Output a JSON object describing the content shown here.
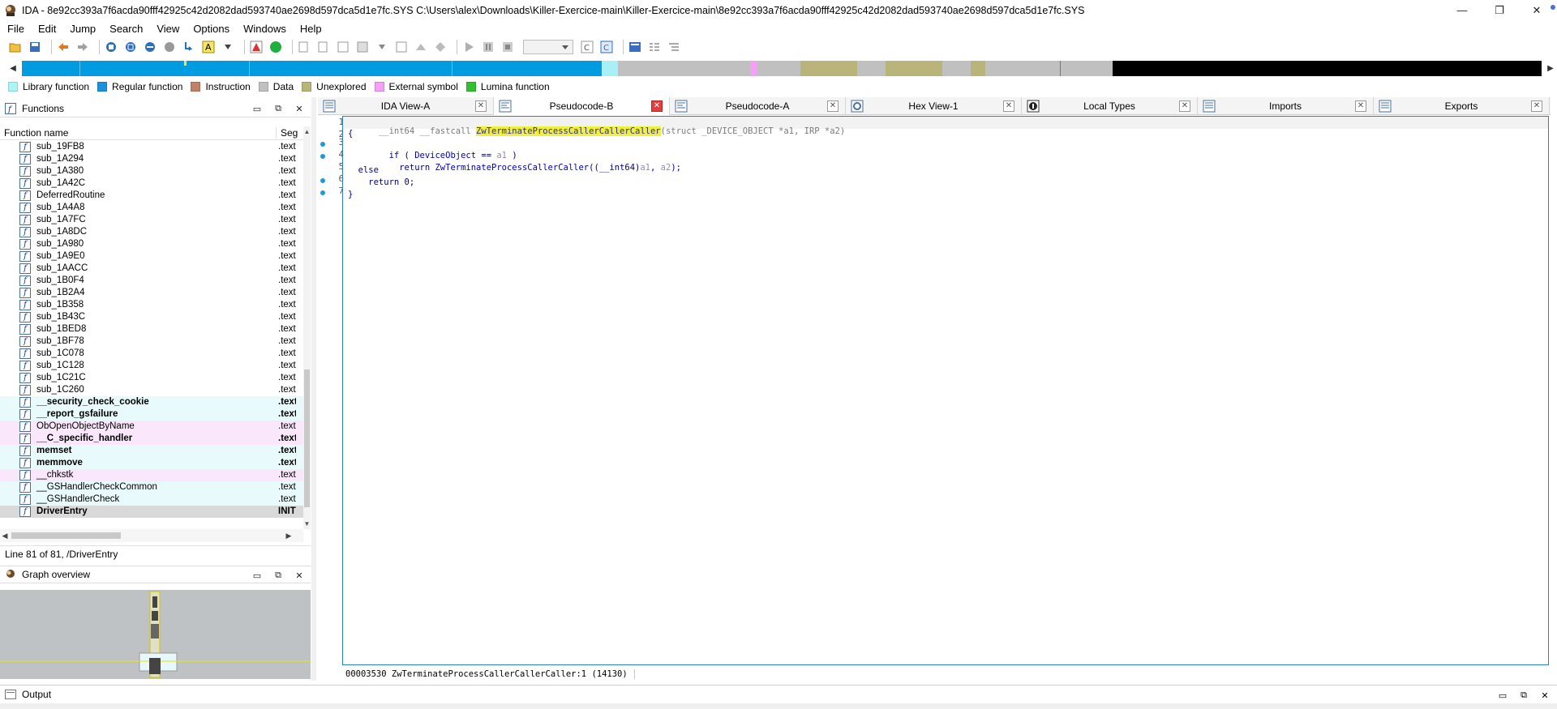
{
  "window": {
    "title": "IDA - 8e92cc393a7f6acda90fff42925c42d2082dad593740ae2698d597dca5d1e7fc.SYS C:\\Users\\alex\\Downloads\\Killer-Exercice-main\\Killer-Exercice-main\\8e92cc393a7f6acda90fff42925c42d2082dad593740ae2698d597dca5d1e7fc.SYS",
    "minimize": "—",
    "restore": "❐",
    "close": "✕"
  },
  "menu": [
    "File",
    "Edit",
    "Jump",
    "Search",
    "View",
    "Options",
    "Windows",
    "Help"
  ],
  "legend": [
    {
      "label": "Library function",
      "color": "#aaf6f6"
    },
    {
      "label": "Regular function",
      "color": "#1e90e0"
    },
    {
      "label": "Instruction",
      "color": "#c0806a"
    },
    {
      "label": "Data",
      "color": "#c0c0c0"
    },
    {
      "label": "Unexplored",
      "color": "#b8b47a"
    },
    {
      "label": "External symbol",
      "color": "#f4a0f4"
    },
    {
      "label": "Lumina function",
      "color": "#30c030"
    }
  ],
  "functions_panel": {
    "title": "Functions",
    "col_name": "Function name",
    "col_seg": "Seg",
    "rows": [
      {
        "name": "sub_19FB8",
        "seg": ".text",
        "kind": "reg"
      },
      {
        "name": "sub_1A294",
        "seg": ".text",
        "kind": "reg"
      },
      {
        "name": "sub_1A380",
        "seg": ".text",
        "kind": "reg"
      },
      {
        "name": "sub_1A42C",
        "seg": ".text",
        "kind": "reg"
      },
      {
        "name": "DeferredRoutine",
        "seg": ".text",
        "kind": "reg"
      },
      {
        "name": "sub_1A4A8",
        "seg": ".text",
        "kind": "reg"
      },
      {
        "name": "sub_1A7FC",
        "seg": ".text",
        "kind": "reg"
      },
      {
        "name": "sub_1A8DC",
        "seg": ".text",
        "kind": "reg"
      },
      {
        "name": "sub_1A980",
        "seg": ".text",
        "kind": "reg"
      },
      {
        "name": "sub_1A9E0",
        "seg": ".text",
        "kind": "reg"
      },
      {
        "name": "sub_1AACC",
        "seg": ".text",
        "kind": "reg"
      },
      {
        "name": "sub_1B0F4",
        "seg": ".text",
        "kind": "reg"
      },
      {
        "name": "sub_1B2A4",
        "seg": ".text",
        "kind": "reg"
      },
      {
        "name": "sub_1B358",
        "seg": ".text",
        "kind": "reg"
      },
      {
        "name": "sub_1B43C",
        "seg": ".text",
        "kind": "reg"
      },
      {
        "name": "sub_1BED8",
        "seg": ".text",
        "kind": "reg"
      },
      {
        "name": "sub_1BF78",
        "seg": ".text",
        "kind": "reg"
      },
      {
        "name": "sub_1C078",
        "seg": ".text",
        "kind": "reg"
      },
      {
        "name": "sub_1C128",
        "seg": ".text",
        "kind": "reg"
      },
      {
        "name": "sub_1C21C",
        "seg": ".text",
        "kind": "reg"
      },
      {
        "name": "sub_1C260",
        "seg": ".text",
        "kind": "reg"
      },
      {
        "name": "__security_check_cookie",
        "seg": ".text",
        "kind": "lib bold"
      },
      {
        "name": "__report_gsfailure",
        "seg": ".text",
        "kind": "lib bold"
      },
      {
        "name": "ObOpenObjectByName",
        "seg": ".text",
        "kind": "ext"
      },
      {
        "name": "__C_specific_handler",
        "seg": ".text",
        "kind": "ext bold"
      },
      {
        "name": "memset",
        "seg": ".text",
        "kind": "lib bold"
      },
      {
        "name": "memmove",
        "seg": ".text",
        "kind": "lib bold"
      },
      {
        "name": "__chkstk",
        "seg": ".text",
        "kind": "ext"
      },
      {
        "name": "__GSHandlerCheckCommon",
        "seg": ".text",
        "kind": "lib"
      },
      {
        "name": "__GSHandlerCheck",
        "seg": ".text",
        "kind": "lib"
      },
      {
        "name": "DriverEntry",
        "seg": "INIT",
        "kind": "sel bold"
      }
    ],
    "line_info": "Line 81 of 81, /DriverEntry"
  },
  "graph_overview": {
    "title": "Graph overview"
  },
  "tabs": [
    {
      "label": "IDA View-A",
      "active": false
    },
    {
      "label": "Pseudocode-B",
      "active": true
    },
    {
      "label": "Pseudocode-A",
      "active": false
    },
    {
      "label": "Hex View-1",
      "active": false
    },
    {
      "label": "Local Types",
      "active": false
    },
    {
      "label": "Imports",
      "active": false
    },
    {
      "label": "Exports",
      "active": false
    }
  ],
  "code": {
    "line_numbers": [
      "1",
      "2",
      "3",
      "4",
      "5",
      "6",
      "7"
    ],
    "l1_ret": "__int64 __fastcall ",
    "l1_name": "ZwTerminateProcessCallerCallerCaller",
    "l1_args": "(struct _DEVICE_OBJECT *a1, IRP *a2)",
    "l2": "{",
    "l3_a": "  if ( ",
    "l3_b": "DeviceObject",
    "l3_c": " == ",
    "l3_d": "a1",
    "l3_e": " )",
    "l4_a": "    return ",
    "l4_b": "ZwTerminateProcessCallerCaller",
    "l4_c": "((__int64)",
    "l4_d": "a1",
    "l4_e": ", ",
    "l4_f": "a2",
    "l4_g": ");",
    "l5": "  else",
    "l6": "    return 0;",
    "l7": "}",
    "status_addr": "00003530",
    "status_text": "ZwTerminateProcessCallerCallerCaller:1 (14130)"
  },
  "output": {
    "title": "Output"
  }
}
